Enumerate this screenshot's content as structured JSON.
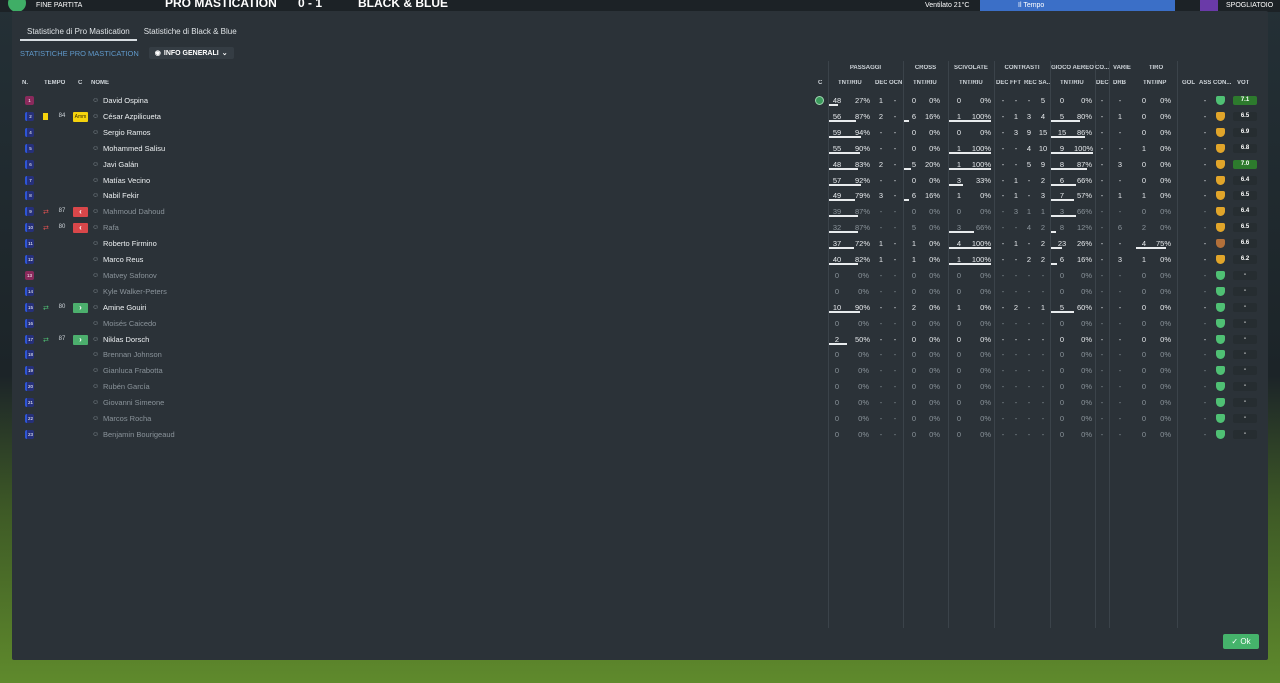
{
  "topbar": {
    "status": "FINE PARTITA",
    "home_team": "PRO MASTICATION",
    "score": "0 - 1",
    "away_team": "BLACK & BLUE",
    "weather": "Ventilato 21°C",
    "time": "Il Tempo",
    "menu": "SPOGLIATOIO"
  },
  "tabs": [
    {
      "label": "Statistiche di Pro Mastication",
      "active": true
    },
    {
      "label": "Statistiche di Black & Blue",
      "active": false
    }
  ],
  "subtitle": "STATISTICHE PRO MASTICATION",
  "view_dropdown": "INFO GENERALI",
  "group_headers": {
    "passaggi": "PASSAGGI",
    "cross": "CROSS",
    "scivolate": "SCIVOLATE",
    "contrasti": "CONTRASTI",
    "gioco_aereo": "GIOCO AEREO",
    "co": "CO...",
    "varie": "VARIE",
    "tiro": "TIRO"
  },
  "col_headers": {
    "n": "N.",
    "tempo": "TEMPO",
    "c": "C",
    "nome": "NOME",
    "cond": "C",
    "pas_tnt": "TNT/RIU",
    "pas_dec": "DEC",
    "pas_ocn": "OCN",
    "cross_tnt": "TNT/RIU",
    "sciv_tnt": "TNT/RIU",
    "con_dec": "DEC",
    "con_fft": "FFT",
    "con_rec": "REC SA...",
    "aer_tnt": "TNT/RIU",
    "co_dec": "DEC",
    "var_drb": "DRB",
    "tiro_tnt": "TNT/INP",
    "gol": "GOL",
    "ass": "ASS",
    "con": "CON...",
    "vot": "VOT"
  },
  "players": [
    {
      "n": "1",
      "pos": "gk",
      "name": "David Ospina",
      "dim": false,
      "tempo": "",
      "cstatus": "cond",
      "ccell": "",
      "pas": [
        "48",
        "27%"
      ],
      "pas_bar": 0.25,
      "pdec": "1",
      "pocn": "-",
      "cross": [
        "0",
        "0%"
      ],
      "cross_bar": 0,
      "sciv": [
        "0",
        "0%"
      ],
      "sciv_bar": 0,
      "cdec": "-",
      "cfft": "-",
      "crec": [
        "-",
        "5"
      ],
      "aer": [
        "0",
        "0%"
      ],
      "aer_bar": 0,
      "codec": "-",
      "drb": "-",
      "tiro": [
        "0",
        "0%"
      ],
      "gol": "",
      "ass": "-",
      "shield": "green",
      "vot": "7.1",
      "vhi": true
    },
    {
      "n": "2",
      "pos": "pl",
      "name": "César Azpilicueta",
      "dim": false,
      "tempo": "84",
      "cstatus": "card",
      "ccell": "Amm",
      "pas": [
        "56",
        "87%"
      ],
      "pas_bar": 0.75,
      "pdec": "2",
      "pocn": "-",
      "cross": [
        "6",
        "16%"
      ],
      "cross_bar": 0.15,
      "sciv": [
        "1",
        "100%"
      ],
      "sciv_bar": 1,
      "cdec": "-",
      "cfft": "1",
      "crec": [
        "3",
        "4"
      ],
      "aer": [
        "5",
        "80%"
      ],
      "aer_bar": 0.7,
      "codec": "-",
      "drb": "1",
      "tiro": [
        "0",
        "0%"
      ],
      "gol": "",
      "ass": "-",
      "shield": "gold",
      "vot": "6.5",
      "vhi": false
    },
    {
      "n": "4",
      "pos": "pl",
      "name": "Sergio Ramos",
      "dim": false,
      "tempo": "",
      "cstatus": "",
      "ccell": "",
      "pas": [
        "59",
        "94%"
      ],
      "pas_bar": 0.9,
      "pdec": "-",
      "pocn": "-",
      "cross": [
        "0",
        "0%"
      ],
      "cross_bar": 0,
      "sciv": [
        "0",
        "0%"
      ],
      "sciv_bar": 0,
      "cdec": "-",
      "cfft": "3",
      "crec": [
        "9",
        "15"
      ],
      "aer": [
        "15",
        "86%"
      ],
      "aer_bar": 0.8,
      "codec": "-",
      "drb": "-",
      "tiro": [
        "0",
        "0%"
      ],
      "gol": "",
      "ass": "-",
      "shield": "gold",
      "vot": "6.9",
      "vhi": false
    },
    {
      "n": "5",
      "pos": "pl",
      "name": "Mohammed Salisu",
      "dim": false,
      "tempo": "",
      "cstatus": "",
      "ccell": "",
      "pas": [
        "55",
        "90%"
      ],
      "pas_bar": 0.85,
      "pdec": "-",
      "pocn": "-",
      "cross": [
        "0",
        "0%"
      ],
      "cross_bar": 0,
      "sciv": [
        "1",
        "100%"
      ],
      "sciv_bar": 1,
      "cdec": "-",
      "cfft": "-",
      "crec": [
        "4",
        "10"
      ],
      "aer": [
        "9",
        "100%"
      ],
      "aer_bar": 1,
      "codec": "-",
      "drb": "-",
      "tiro": [
        "1",
        "0%"
      ],
      "gol": "",
      "ass": "-",
      "shield": "gold",
      "vot": "6.8",
      "vhi": false
    },
    {
      "n": "6",
      "pos": "pl",
      "name": "Javi Galán",
      "dim": false,
      "tempo": "",
      "cstatus": "",
      "ccell": "",
      "pas": [
        "48",
        "83%"
      ],
      "pas_bar": 0.8,
      "pdec": "2",
      "pocn": "-",
      "cross": [
        "5",
        "20%"
      ],
      "cross_bar": 0.2,
      "sciv": [
        "1",
        "100%"
      ],
      "sciv_bar": 1,
      "cdec": "-",
      "cfft": "-",
      "crec": [
        "5",
        "9"
      ],
      "aer": [
        "8",
        "87%"
      ],
      "aer_bar": 0.85,
      "codec": "-",
      "drb": "3",
      "tiro": [
        "0",
        "0%"
      ],
      "gol": "",
      "ass": "-",
      "shield": "gold",
      "vot": "7.0",
      "vhi": true
    },
    {
      "n": "7",
      "pos": "pl",
      "name": "Matías Vecino",
      "dim": false,
      "tempo": "",
      "cstatus": "",
      "ccell": "",
      "pas": [
        "57",
        "92%"
      ],
      "pas_bar": 0.88,
      "pdec": "-",
      "pocn": "-",
      "cross": [
        "0",
        "0%"
      ],
      "cross_bar": 0,
      "sciv": [
        "3",
        "33%"
      ],
      "sciv_bar": 0.33,
      "cdec": "-",
      "cfft": "1",
      "crec": [
        "-",
        "2"
      ],
      "aer": [
        "6",
        "66%"
      ],
      "aer_bar": 0.6,
      "codec": "-",
      "drb": "-",
      "tiro": [
        "0",
        "0%"
      ],
      "gol": "",
      "ass": "-",
      "shield": "gold",
      "vot": "6.4",
      "vhi": false
    },
    {
      "n": "8",
      "pos": "pl",
      "name": "Nabil Fekir",
      "dim": false,
      "tempo": "",
      "cstatus": "",
      "ccell": "",
      "pas": [
        "49",
        "79%"
      ],
      "pas_bar": 0.72,
      "pdec": "3",
      "pocn": "-",
      "cross": [
        "6",
        "16%"
      ],
      "cross_bar": 0.15,
      "sciv": [
        "1",
        "0%"
      ],
      "sciv_bar": 0,
      "cdec": "-",
      "cfft": "1",
      "crec": [
        "-",
        "3"
      ],
      "aer": [
        "7",
        "57%"
      ],
      "aer_bar": 0.55,
      "codec": "-",
      "drb": "1",
      "tiro": [
        "1",
        "0%"
      ],
      "gol": "",
      "ass": "-",
      "shield": "gold",
      "vot": "6.5",
      "vhi": false
    },
    {
      "n": "9",
      "pos": "pl",
      "name": "Mahmoud Dahoud",
      "dim": true,
      "tempo": "87",
      "cstatus": "out",
      "ccell": "out",
      "pas": [
        "39",
        "87%"
      ],
      "pas_bar": 0.8,
      "pdec": "-",
      "pocn": "-",
      "cross": [
        "0",
        "0%"
      ],
      "cross_bar": 0,
      "sciv": [
        "0",
        "0%"
      ],
      "sciv_bar": 0,
      "cdec": "-",
      "cfft": "3",
      "crec": [
        "1",
        "1"
      ],
      "aer": [
        "3",
        "66%"
      ],
      "aer_bar": 0.6,
      "codec": "-",
      "drb": "-",
      "tiro": [
        "0",
        "0%"
      ],
      "gol": "",
      "ass": "-",
      "shield": "gold",
      "vot": "6.4",
      "vhi": false
    },
    {
      "n": "10",
      "pos": "pl",
      "name": "Rafa",
      "dim": true,
      "tempo": "80",
      "cstatus": "out",
      "ccell": "out",
      "pas": [
        "32",
        "87%"
      ],
      "pas_bar": 0.8,
      "pdec": "-",
      "pocn": "-",
      "cross": [
        "5",
        "0%"
      ],
      "cross_bar": 0,
      "sciv": [
        "3",
        "66%"
      ],
      "sciv_bar": 0.6,
      "cdec": "-",
      "cfft": "-",
      "crec": [
        "4",
        "2"
      ],
      "aer": [
        "8",
        "12%"
      ],
      "aer_bar": 0.12,
      "codec": "-",
      "drb": "6",
      "tiro": [
        "2",
        "0%"
      ],
      "gol": "",
      "ass": "-",
      "shield": "gold",
      "vot": "6.5",
      "vhi": false
    },
    {
      "n": "11",
      "pos": "pl",
      "name": "Roberto Firmino",
      "dim": false,
      "tempo": "",
      "cstatus": "",
      "ccell": "",
      "pas": [
        "37",
        "72%"
      ],
      "pas_bar": 0.7,
      "pdec": "1",
      "pocn": "-",
      "cross": [
        "1",
        "0%"
      ],
      "cross_bar": 0,
      "sciv": [
        "4",
        "100%"
      ],
      "sciv_bar": 1,
      "cdec": "-",
      "cfft": "1",
      "crec": [
        "-",
        "2"
      ],
      "aer": [
        "23",
        "26%"
      ],
      "aer_bar": 0.25,
      "codec": "-",
      "drb": "-",
      "tiro": [
        "4",
        "75%"
      ],
      "gol": "",
      "ass": "-",
      "shield": "bronze",
      "vot": "6.6",
      "vhi": false
    },
    {
      "n": "12",
      "pos": "pl",
      "name": "Marco Reus",
      "dim": false,
      "tempo": "",
      "cstatus": "",
      "ccell": "",
      "pas": [
        "40",
        "82%"
      ],
      "pas_bar": 0.8,
      "pdec": "1",
      "pocn": "-",
      "cross": [
        "1",
        "0%"
      ],
      "cross_bar": 0,
      "sciv": [
        "1",
        "100%"
      ],
      "sciv_bar": 1,
      "cdec": "-",
      "cfft": "-",
      "crec": [
        "2",
        "2"
      ],
      "aer": [
        "6",
        "16%"
      ],
      "aer_bar": 0.15,
      "codec": "-",
      "drb": "3",
      "tiro": [
        "1",
        "0%"
      ],
      "gol": "",
      "ass": "-",
      "shield": "gold",
      "vot": "6.2",
      "vhi": false
    },
    {
      "n": "13",
      "pos": "gk",
      "name": "Matvey Safonov",
      "dim": true,
      "tempo": "",
      "cstatus": "",
      "ccell": "",
      "pas": [
        "0",
        "0%"
      ],
      "pas_bar": 0,
      "pdec": "-",
      "pocn": "-",
      "cross": [
        "0",
        "0%"
      ],
      "cross_bar": 0,
      "sciv": [
        "0",
        "0%"
      ],
      "sciv_bar": 0,
      "cdec": "-",
      "cfft": "-",
      "crec": [
        "-",
        "-"
      ],
      "aer": [
        "0",
        "0%"
      ],
      "aer_bar": 0,
      "codec": "-",
      "drb": "-",
      "tiro": [
        "0",
        "0%"
      ],
      "gol": "",
      "ass": "-",
      "shield": "green",
      "vot": "-",
      "vhi": false
    },
    {
      "n": "14",
      "pos": "pl",
      "name": "Kyle Walker-Peters",
      "dim": true,
      "tempo": "",
      "cstatus": "",
      "ccell": "",
      "pas": [
        "0",
        "0%"
      ],
      "pas_bar": 0,
      "pdec": "-",
      "pocn": "-",
      "cross": [
        "0",
        "0%"
      ],
      "cross_bar": 0,
      "sciv": [
        "0",
        "0%"
      ],
      "sciv_bar": 0,
      "cdec": "-",
      "cfft": "-",
      "crec": [
        "-",
        "-"
      ],
      "aer": [
        "0",
        "0%"
      ],
      "aer_bar": 0,
      "codec": "-",
      "drb": "-",
      "tiro": [
        "0",
        "0%"
      ],
      "gol": "",
      "ass": "-",
      "shield": "green",
      "vot": "-",
      "vhi": false
    },
    {
      "n": "15",
      "pos": "pl",
      "name": "Amine Gouiri",
      "dim": false,
      "tempo": "80",
      "cstatus": "in",
      "ccell": "in",
      "pas": [
        "10",
        "90%"
      ],
      "pas_bar": 0.85,
      "pdec": "-",
      "pocn": "-",
      "cross": [
        "2",
        "0%"
      ],
      "cross_bar": 0,
      "sciv": [
        "1",
        "0%"
      ],
      "sciv_bar": 0,
      "cdec": "-",
      "cfft": "2",
      "crec": [
        "-",
        "1"
      ],
      "aer": [
        "5",
        "60%"
      ],
      "aer_bar": 0.55,
      "codec": "-",
      "drb": "-",
      "tiro": [
        "0",
        "0%"
      ],
      "gol": "",
      "ass": "-",
      "shield": "green",
      "vot": "-",
      "vhi": false
    },
    {
      "n": "16",
      "pos": "pl",
      "name": "Moisés Caicedo",
      "dim": true,
      "tempo": "",
      "cstatus": "",
      "ccell": "",
      "pas": [
        "0",
        "0%"
      ],
      "pas_bar": 0,
      "pdec": "-",
      "pocn": "-",
      "cross": [
        "0",
        "0%"
      ],
      "cross_bar": 0,
      "sciv": [
        "0",
        "0%"
      ],
      "sciv_bar": 0,
      "cdec": "-",
      "cfft": "-",
      "crec": [
        "-",
        "-"
      ],
      "aer": [
        "0",
        "0%"
      ],
      "aer_bar": 0,
      "codec": "-",
      "drb": "-",
      "tiro": [
        "0",
        "0%"
      ],
      "gol": "",
      "ass": "-",
      "shield": "green",
      "vot": "-",
      "vhi": false
    },
    {
      "n": "17",
      "pos": "pl",
      "name": "Niklas Dorsch",
      "dim": false,
      "tempo": "87",
      "cstatus": "in",
      "ccell": "in",
      "pas": [
        "2",
        "50%"
      ],
      "pas_bar": 0.5,
      "pdec": "-",
      "pocn": "-",
      "cross": [
        "0",
        "0%"
      ],
      "cross_bar": 0,
      "sciv": [
        "0",
        "0%"
      ],
      "sciv_bar": 0,
      "cdec": "-",
      "cfft": "-",
      "crec": [
        "-",
        "-"
      ],
      "aer": [
        "0",
        "0%"
      ],
      "aer_bar": 0,
      "codec": "-",
      "drb": "-",
      "tiro": [
        "0",
        "0%"
      ],
      "gol": "",
      "ass": "-",
      "shield": "green",
      "vot": "-",
      "vhi": false
    },
    {
      "n": "18",
      "pos": "pl",
      "name": "Brennan Johnson",
      "dim": true,
      "tempo": "",
      "cstatus": "",
      "ccell": "",
      "pas": [
        "0",
        "0%"
      ],
      "pas_bar": 0,
      "pdec": "-",
      "pocn": "-",
      "cross": [
        "0",
        "0%"
      ],
      "cross_bar": 0,
      "sciv": [
        "0",
        "0%"
      ],
      "sciv_bar": 0,
      "cdec": "-",
      "cfft": "-",
      "crec": [
        "-",
        "-"
      ],
      "aer": [
        "0",
        "0%"
      ],
      "aer_bar": 0,
      "codec": "-",
      "drb": "-",
      "tiro": [
        "0",
        "0%"
      ],
      "gol": "",
      "ass": "-",
      "shield": "green",
      "vot": "-",
      "vhi": false
    },
    {
      "n": "19",
      "pos": "pl",
      "name": "Gianluca Frabotta",
      "dim": true,
      "tempo": "",
      "cstatus": "",
      "ccell": "",
      "pas": [
        "0",
        "0%"
      ],
      "pas_bar": 0,
      "pdec": "-",
      "pocn": "-",
      "cross": [
        "0",
        "0%"
      ],
      "cross_bar": 0,
      "sciv": [
        "0",
        "0%"
      ],
      "sciv_bar": 0,
      "cdec": "-",
      "cfft": "-",
      "crec": [
        "-",
        "-"
      ],
      "aer": [
        "0",
        "0%"
      ],
      "aer_bar": 0,
      "codec": "-",
      "drb": "-",
      "tiro": [
        "0",
        "0%"
      ],
      "gol": "",
      "ass": "-",
      "shield": "green",
      "vot": "-",
      "vhi": false
    },
    {
      "n": "20",
      "pos": "pl",
      "name": "Rubén García",
      "dim": true,
      "tempo": "",
      "cstatus": "",
      "ccell": "",
      "pas": [
        "0",
        "0%"
      ],
      "pas_bar": 0,
      "pdec": "-",
      "pocn": "-",
      "cross": [
        "0",
        "0%"
      ],
      "cross_bar": 0,
      "sciv": [
        "0",
        "0%"
      ],
      "sciv_bar": 0,
      "cdec": "-",
      "cfft": "-",
      "crec": [
        "-",
        "-"
      ],
      "aer": [
        "0",
        "0%"
      ],
      "aer_bar": 0,
      "codec": "-",
      "drb": "-",
      "tiro": [
        "0",
        "0%"
      ],
      "gol": "",
      "ass": "-",
      "shield": "green",
      "vot": "-",
      "vhi": false
    },
    {
      "n": "21",
      "pos": "pl",
      "name": "Giovanni Simeone",
      "dim": true,
      "tempo": "",
      "cstatus": "",
      "ccell": "",
      "pas": [
        "0",
        "0%"
      ],
      "pas_bar": 0,
      "pdec": "-",
      "pocn": "-",
      "cross": [
        "0",
        "0%"
      ],
      "cross_bar": 0,
      "sciv": [
        "0",
        "0%"
      ],
      "sciv_bar": 0,
      "cdec": "-",
      "cfft": "-",
      "crec": [
        "-",
        "-"
      ],
      "aer": [
        "0",
        "0%"
      ],
      "aer_bar": 0,
      "codec": "-",
      "drb": "-",
      "tiro": [
        "0",
        "0%"
      ],
      "gol": "",
      "ass": "-",
      "shield": "green",
      "vot": "-",
      "vhi": false
    },
    {
      "n": "22",
      "pos": "pl",
      "name": "Marcos Rocha",
      "dim": true,
      "tempo": "",
      "cstatus": "",
      "ccell": "",
      "pas": [
        "0",
        "0%"
      ],
      "pas_bar": 0,
      "pdec": "-",
      "pocn": "-",
      "cross": [
        "0",
        "0%"
      ],
      "cross_bar": 0,
      "sciv": [
        "0",
        "0%"
      ],
      "sciv_bar": 0,
      "cdec": "-",
      "cfft": "-",
      "crec": [
        "-",
        "-"
      ],
      "aer": [
        "0",
        "0%"
      ],
      "aer_bar": 0,
      "codec": "-",
      "drb": "-",
      "tiro": [
        "0",
        "0%"
      ],
      "gol": "",
      "ass": "-",
      "shield": "green",
      "vot": "-",
      "vhi": false
    },
    {
      "n": "23",
      "pos": "pl",
      "name": "Benjamin Bourigeaud",
      "dim": true,
      "tempo": "",
      "cstatus": "",
      "ccell": "",
      "pas": [
        "0",
        "0%"
      ],
      "pas_bar": 0,
      "pdec": "-",
      "pocn": "-",
      "cross": [
        "0",
        "0%"
      ],
      "cross_bar": 0,
      "sciv": [
        "0",
        "0%"
      ],
      "sciv_bar": 0,
      "cdec": "-",
      "cfft": "-",
      "crec": [
        "-",
        "-"
      ],
      "aer": [
        "0",
        "0%"
      ],
      "aer_bar": 0,
      "codec": "-",
      "drb": "-",
      "tiro": [
        "0",
        "0%"
      ],
      "gol": "",
      "ass": "-",
      "shield": "green",
      "vot": "-",
      "vhi": false
    }
  ],
  "ok_label": "Ok",
  "colors": {
    "accent_blue": "#5f98c9",
    "ok_green": "#45b36b",
    "card_yellow": "#f5d30d",
    "sub_in": "#4caf6d",
    "sub_out": "#d9474a"
  }
}
